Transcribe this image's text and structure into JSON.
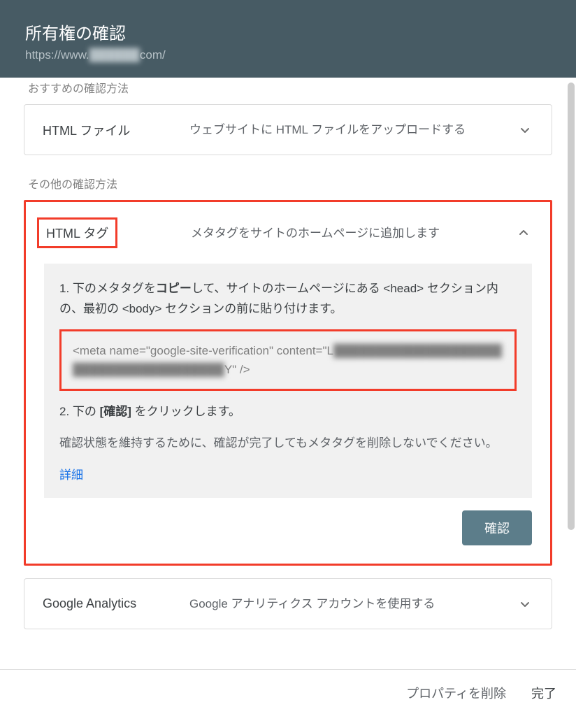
{
  "header": {
    "title": "所有権の確認",
    "url_prefix": "https://www.",
    "url_domain": "██████",
    "url_suffix": "com/"
  },
  "sections": {
    "recommended": "おすすめの確認方法",
    "other": "その他の確認方法"
  },
  "methods": {
    "html_file": {
      "title": "HTML ファイル",
      "desc": "ウェブサイトに HTML ファイルをアップロードする"
    },
    "html_tag": {
      "title": "HTML タグ",
      "desc": "メタタグをサイトのホームページに追加します",
      "step1_pre": "1. 下のメタタグを",
      "step1_copy": "コピー",
      "step1_post": "して、サイトのホームページにある <head> セクション内の、最初の <body> セクションの前に貼り付けます。",
      "meta_code_visible": "<meta name=\"google-site-verification\" content=\"L",
      "meta_code_hidden": "██████████████████████████████████████",
      "meta_code_end": "Y\" />",
      "step2_pre": "2. 下の ",
      "step2_bold": "[確認]",
      "step2_post": " をクリックします。",
      "note": "確認状態を維持するために、確認が完了してもメタタグを削除しないでください。",
      "details": "詳細",
      "confirm": "確認"
    },
    "analytics": {
      "title": "Google Analytics",
      "desc": "Google アナリティクス アカウントを使用する"
    }
  },
  "footer": {
    "delete": "プロパティを削除",
    "done": "完了"
  }
}
